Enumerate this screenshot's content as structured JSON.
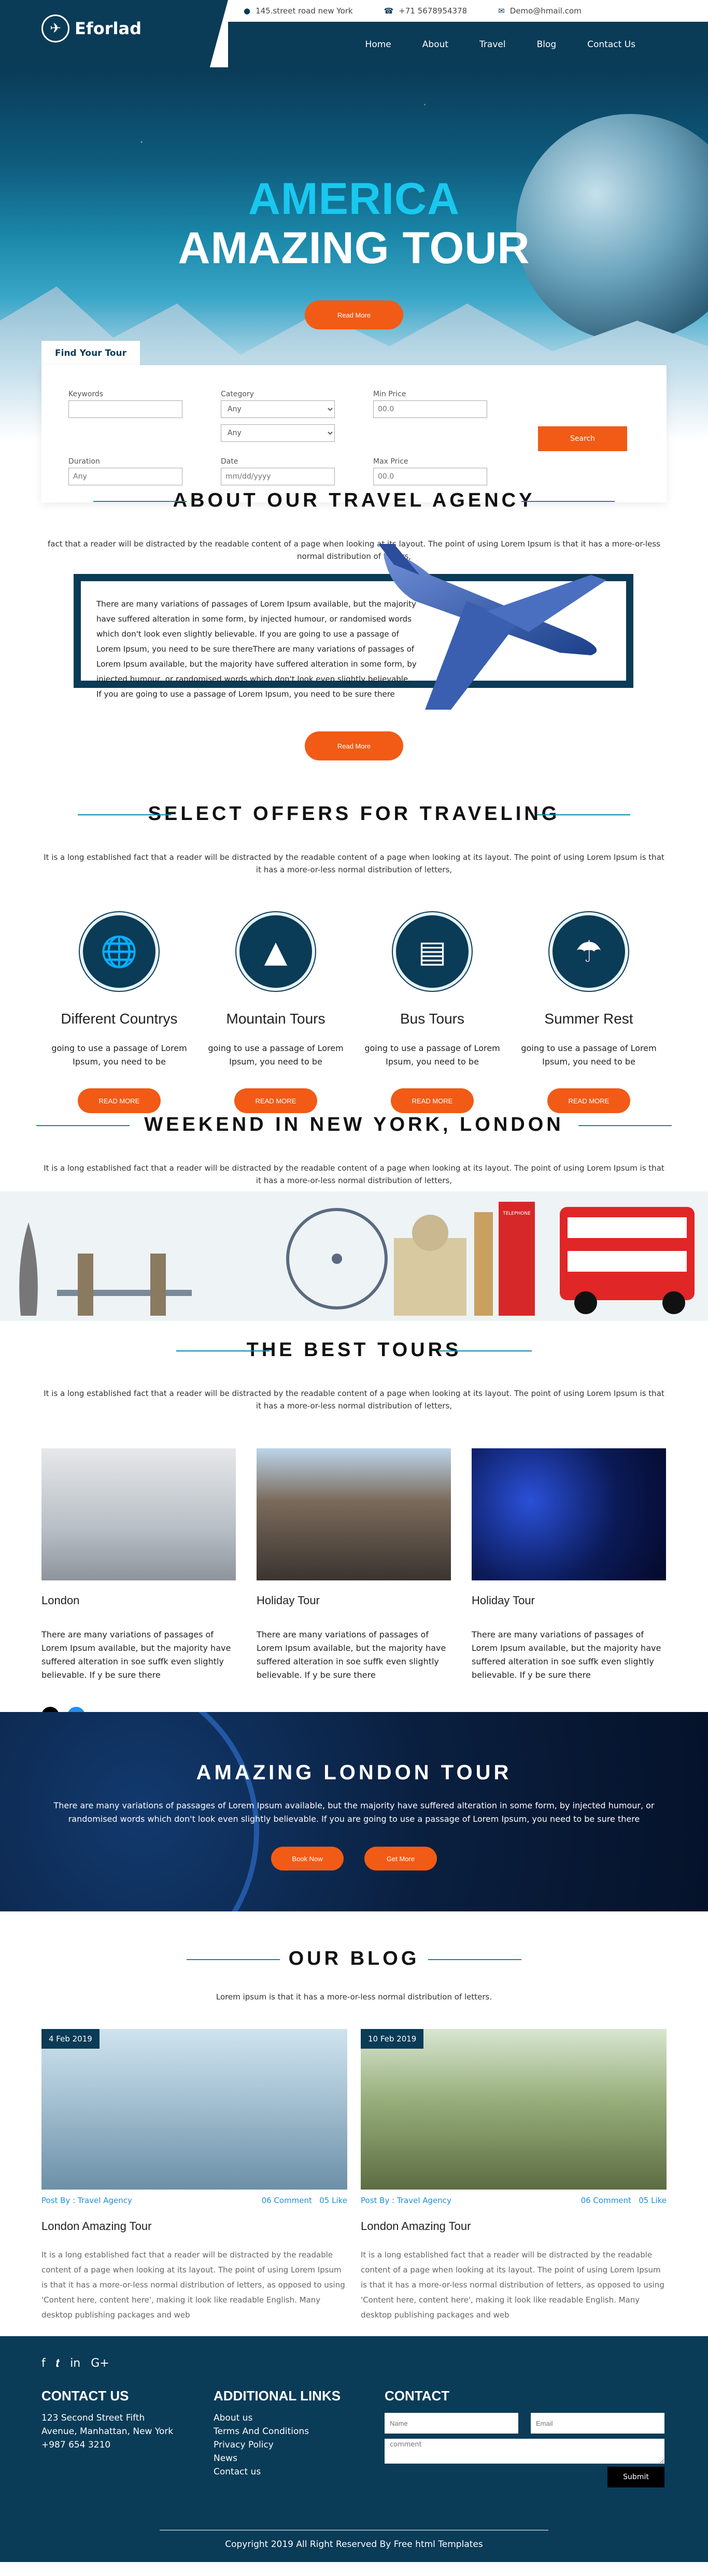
{
  "brand": {
    "name": "Eforlad"
  },
  "contact_bar": {
    "address": "145.street road new York",
    "phone": "+71 5678954378",
    "email": "Demo@hmail.com"
  },
  "nav": {
    "items": [
      "Home",
      "About",
      "Travel",
      "Blog",
      "Contact Us"
    ]
  },
  "hero": {
    "line1": "AMERICA",
    "line2": "AMAZING TOUR",
    "button": "Read More"
  },
  "search": {
    "tab": "Find Your Tour",
    "keywords_label": "Keywords",
    "keywords_value": "",
    "category_label": "Category",
    "category_value": "Any",
    "category2_value": "Any",
    "min_price_label": "Min Price",
    "min_price_placeholder": "00.0",
    "duration_label": "Duration",
    "duration_placeholder": "Any",
    "date_label": "Date",
    "date_placeholder": "mm/dd/yyyy",
    "max_price_label": "Max Price",
    "max_price_placeholder": "00.0",
    "button": "Search"
  },
  "about": {
    "title": "ABOUT OUR TRAVEL AGENCY",
    "subtitle": "fact that a reader will be distracted by the readable content of a page when looking at its layout. The point of using Lorem Ipsum is that it has a more-or-less normal distribution of letters,",
    "body": "There are many variations of passages of Lorem Ipsum available, but the majority have suffered alteration in some form, by injected humour, or randomised words which don't look even slightly believable. If you are going to use a passage of Lorem Ipsum, you need to be sure thereThere are many variations of passages of Lorem Ipsum available, but the majority have suffered alteration in some form, by injected humour, or randomised words which don't look even slightly believable. If you are going to use a passage of Lorem Ipsum, you need to be sure there",
    "button": "Read More"
  },
  "offers": {
    "title": "SELECT OFFERS FOR TRAVELING",
    "subtitle": "It is a long established fact that a reader will be distracted by the readable content of a page when looking at its layout. The point of using Lorem Ipsum is that it has a more-or-less normal distribution of letters,",
    "cards": [
      {
        "icon": "globe-icon",
        "title": "Different Countrys",
        "text": "going to use a passage of Lorem Ipsum, you need to be",
        "button": "READ MORE"
      },
      {
        "icon": "mountain-icon",
        "title": "Mountain Tours",
        "text": "going to use a passage of Lorem Ipsum, you need to be",
        "button": "READ MORE"
      },
      {
        "icon": "bus-icon",
        "title": "Bus Tours",
        "text": "going to use a passage of Lorem Ipsum, you need to be",
        "button": "READ MORE"
      },
      {
        "icon": "umbrella-icon",
        "title": "Summer Rest",
        "text": "going to use a passage of Lorem Ipsum, you need to be",
        "button": "READ MORE"
      }
    ]
  },
  "weekend": {
    "title": "WEEKEND IN NEW YORK, LONDON",
    "subtitle": "It is a long established fact that a reader will be distracted by the readable content of a page when looking at its layout. The point of using Lorem Ipsum is that it has a more-or-less normal distribution of letters,",
    "booth_label": "TELEPHONE"
  },
  "tours": {
    "title": "THE BEST TOURS",
    "subtitle": "It is a long established fact that a reader will be distracted by the readable content of a page when looking at its layout. The point of using Lorem Ipsum is that it has a more-or-less normal distribution of letters,",
    "items": [
      {
        "title": "London",
        "text": "There are many variations of passages of Lorem Ipsum available, but the majority have suffered alteration in soe suffk even slightly believable. If y be sure there"
      },
      {
        "title": "Holiday Tour",
        "text": "There are many variations of passages of Lorem Ipsum available, but the majority have suffered alteration in soe suffk even slightly believable. If y be sure there"
      },
      {
        "title": "Holiday Tour",
        "text": "There are many variations of passages of Lorem Ipsum available, but the majority have suffered alteration in soe suffk even slightly believable. If y be sure there"
      }
    ]
  },
  "london": {
    "title": "AMAZING LONDON TOUR",
    "text": "There are many variations of passages of Lorem Ipsum available, but the majority have suffered alteration in some form, by injected humour, or randomised words which don't look even slightly believable. If you are going to use a passage of Lorem Ipsum, you need to be sure there",
    "book": "Book Now",
    "get": "Get More"
  },
  "blog": {
    "title": "OUR BLOG",
    "subtitle": "Lorem ipsum is that it has a more-or-less normal distribution of letters.",
    "posts": [
      {
        "date": "4 Feb 2019",
        "author": "Post By : Travel Agency",
        "comments": "06 Comment",
        "likes": "05 Like",
        "title": "London Amazing Tour",
        "text": "It is a long established fact that a reader will be distracted by the readable content of a page when looking at its layout. The point of using Lorem Ipsum is that it has a more-or-less normal distribution of letters, as opposed to using 'Content here, content here', making it look like readable English. Many desktop publishing packages and web"
      },
      {
        "date": "10 Feb 2019",
        "author": "Post By : Travel Agency",
        "comments": "06 Comment",
        "likes": "05 Like",
        "title": "London Amazing Tour",
        "text": "It is a long established fact that a reader will be distracted by the readable content of a page when looking at its layout. The point of using Lorem Ipsum is that it has a more-or-less normal distribution of letters, as opposed to using 'Content here, content here', making it look like readable English. Many desktop publishing packages and web"
      }
    ]
  },
  "footer": {
    "contact_title": "CONTACT US",
    "address": "123 Second Street Fifth Avenue, Manhattan, New York +987 654 3210",
    "links_title": "ADDITIONAL LINKS",
    "links": [
      "About us",
      "Terms And Conditions",
      "Privacy Policy",
      "News",
      "Contact us"
    ],
    "form_title": "CONTACT",
    "name_placeholder": "Name",
    "email_placeholder": "Email",
    "comment_placeholder": "comment",
    "submit": "Submit",
    "copyright": "Copyright 2019 All Right Reserved By Free html Templates"
  },
  "colors": {
    "primary": "#0a3b57",
    "accent": "#f15b16",
    "cyan": "#19c8ef",
    "link": "#1d8fd6"
  }
}
